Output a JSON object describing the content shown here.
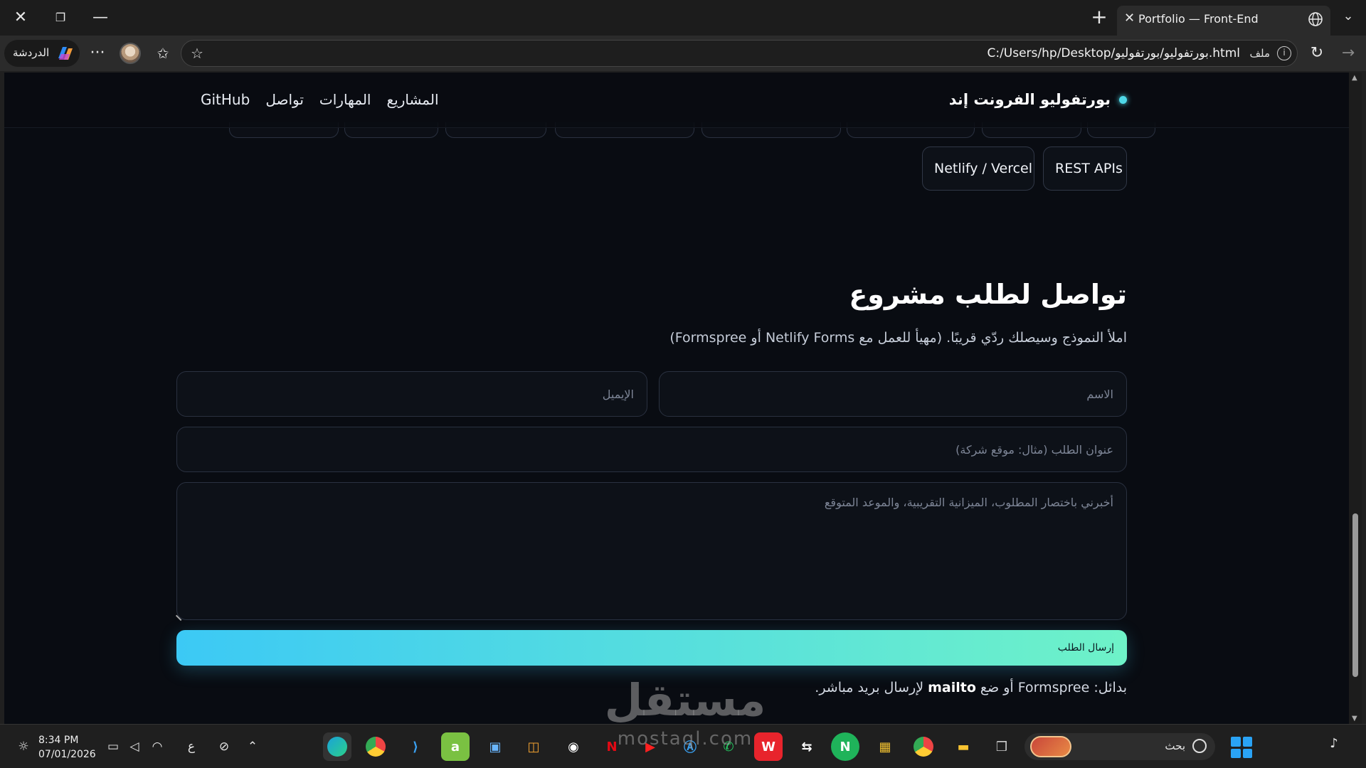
{
  "browser": {
    "tab_title": "Portfolio — Front-End",
    "address_url": "C:/Users/hp/Desktop/بورتفوليو/بورتفوليو.html",
    "address_scheme_label": "ملف",
    "copilot_label": "الدردشة"
  },
  "site": {
    "brand": "بورتفوليو الفرونت إند",
    "nav": [
      "المشاريع",
      "المهارات",
      "تواصل",
      "GitHub"
    ],
    "skill_chips": [
      "REST APIs",
      "Netlify / Vercel"
    ],
    "contact": {
      "title": "تواصل لطلب مشروع",
      "description": "املأ النموذج وسيصلك ردّي قريبًا. (مهيأ للعمل مع Netlify Forms أو Formspree)",
      "name_placeholder": "الاسم",
      "email_placeholder": "الإيميل",
      "subject_placeholder": "عنوان الطلب (مثال: موقع شركة)",
      "message_placeholder": "أخبرني باختصار المطلوب، الميزانية التقريبية، والموعد المتوقع",
      "submit_label": "إرسال الطلب",
      "alt_prefix": "بدائل: Formspree أو ضع ",
      "alt_bold": "mailto",
      "alt_suffix": " لإرسال بريد مباشر."
    }
  },
  "watermark": {
    "arabic": "مستقل",
    "latin": "mostaql.com"
  },
  "taskbar": {
    "time": "8:34 PM",
    "date": "07/01/2026",
    "lang": "ع",
    "search_label": "بحث"
  },
  "colors": {
    "page_bg": "#090c12",
    "accent_start": "#3cc9f5",
    "accent_end": "#6ef2c8",
    "brand_dot": "#4fd8e8"
  }
}
